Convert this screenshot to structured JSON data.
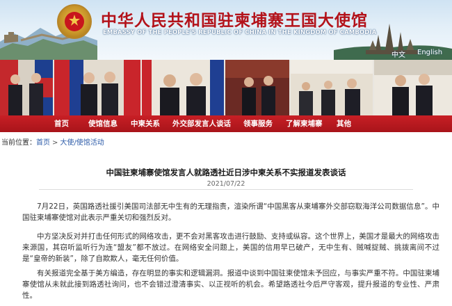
{
  "header": {
    "title_cn": "中华人民共和国驻柬埔寨王国大使馆",
    "title_en": "EMBASSY OF THE PEOPLE'S REPUBLIC OF CHINA IN THE KINGDOM OF CAMBODIA",
    "lang_zh": "中文",
    "lang_en": "English"
  },
  "nav": {
    "items": [
      {
        "label": "首页"
      },
      {
        "label": "使馆信息"
      },
      {
        "label": "中柬关系"
      },
      {
        "label": "外交部发言人谈话"
      },
      {
        "label": "领事服务"
      },
      {
        "label": "了解柬埔寨"
      },
      {
        "label": "其他"
      }
    ]
  },
  "breadcrumb": {
    "prefix": "当前位置：",
    "home": "首页",
    "sep1": ">",
    "section": "大使/使馆活动"
  },
  "article": {
    "title": "中国驻柬埔寨使馆发言人就路透社近日涉中柬关系不实报道发表谈话",
    "date": "2021/07/22",
    "paragraphs": [
      "7月22日，英国路透社援引美国司法部无中生有的无理指责，渲染所谓“中国黑客从柬埔寨外交部窃取海洋公司数据信息”。中国驻柬埔寨使馆对此表示严重关切和强烈反对。",
      "中方坚决反对并打击任何形式的网络攻击，更不会对黑客攻击进行鼓励、支持或纵容。这个世界上，美国才是最大的网络攻击来源国，其窃听监听行为连“盟友”都不放过。在网络安全问题上，美国的信用早已破产，无中生有、贼喊捉贼、挑拨离间不过是“皇帝的新装”，除了自欺欺人，毫无任何价值。",
      "有关报道完全基于美方编造，存在明显的事实和逻辑漏洞。报道中谈到中国驻柬使馆未予回应，与事实严重不符。中国驻柬埔寨使馆从未就此接到路透社询问，也不会错过澄清事实、以正视听的机会。希望路透社今后严守客观，提升报道的专业性、严肃性。"
    ]
  },
  "colors": {
    "nav_red": "#b3121a",
    "title_red": "#b3121a",
    "link_blue": "#2b5aa8"
  }
}
